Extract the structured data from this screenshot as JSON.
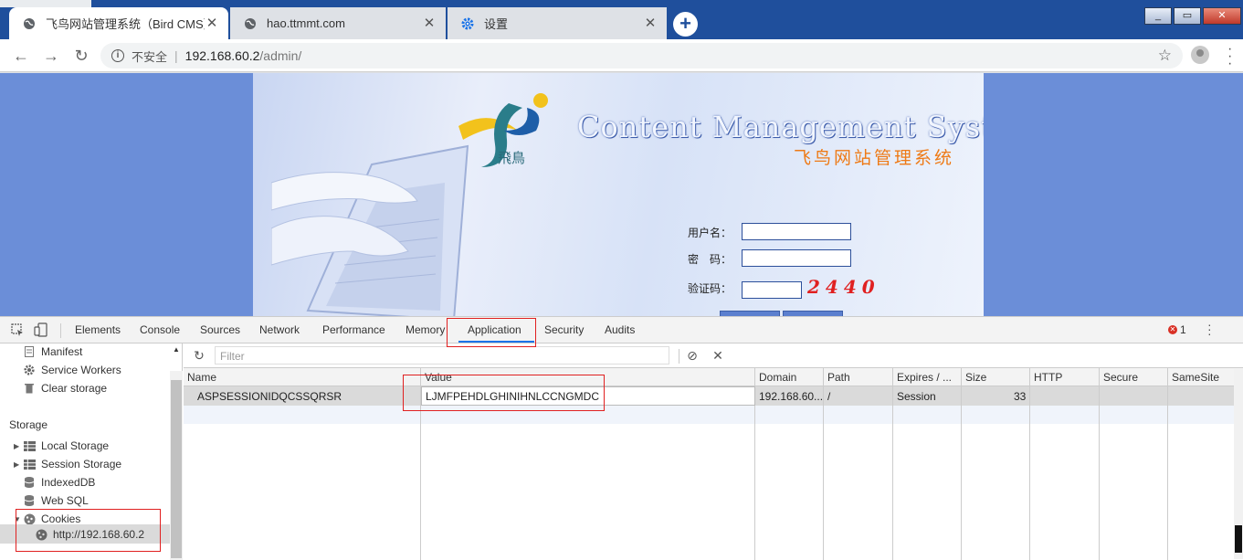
{
  "browser": {
    "tabs": [
      {
        "title": "飞鸟网站管理系统（Bird CMS）",
        "icon": "globe-icon",
        "active": true
      },
      {
        "title": "hao.ttmmt.com",
        "icon": "globe-icon",
        "active": false
      },
      {
        "title": "设置",
        "icon": "gear-icon",
        "active": false
      }
    ],
    "new_tab_label": "+",
    "close_glyph": "✕"
  },
  "address_bar": {
    "security_label": "不安全",
    "host": "192.168.60.2",
    "path": "/admin/"
  },
  "page": {
    "cms_title": "Content Management System",
    "cms_subtitle": "飞鸟网站管理系统",
    "logo_text": "飛鳥",
    "username_label": "用户名：",
    "password_label": "密　码：",
    "captcha_label": "验证码：",
    "captcha_value": "2440"
  },
  "devtools": {
    "tabs": [
      "Elements",
      "Console",
      "Sources",
      "Network",
      "Performance",
      "Memory",
      "Application",
      "Security",
      "Audits"
    ],
    "active_tab": "Application",
    "error_count": "1",
    "sidebar": {
      "manifest": "Manifest",
      "service_workers": "Service Workers",
      "clear_storage": "Clear storage",
      "storage_heading": "Storage",
      "local_storage": "Local Storage",
      "session_storage": "Session Storage",
      "indexeddb": "IndexedDB",
      "web_sql": "Web SQL",
      "cookies": "Cookies",
      "cookies_origin": "http://192.168.60.2"
    },
    "filter_placeholder": "Filter",
    "columns": [
      "Name",
      "Value",
      "Domain",
      "Path",
      "Expires / ...",
      "Size",
      "HTTP",
      "Secure",
      "SameSite"
    ],
    "cookie_row": {
      "name": "ASPSESSIONIDQCSSQRSR",
      "value": "LJMFPEHDLGHINIHNLCCNGMDC",
      "domain": "192.168.60...",
      "path": "/",
      "expires": "Session",
      "size": "33"
    }
  },
  "colors": {
    "highlight_box": "#e02020",
    "accent": "#1a73e8",
    "page_background": "#6b8ed8"
  }
}
